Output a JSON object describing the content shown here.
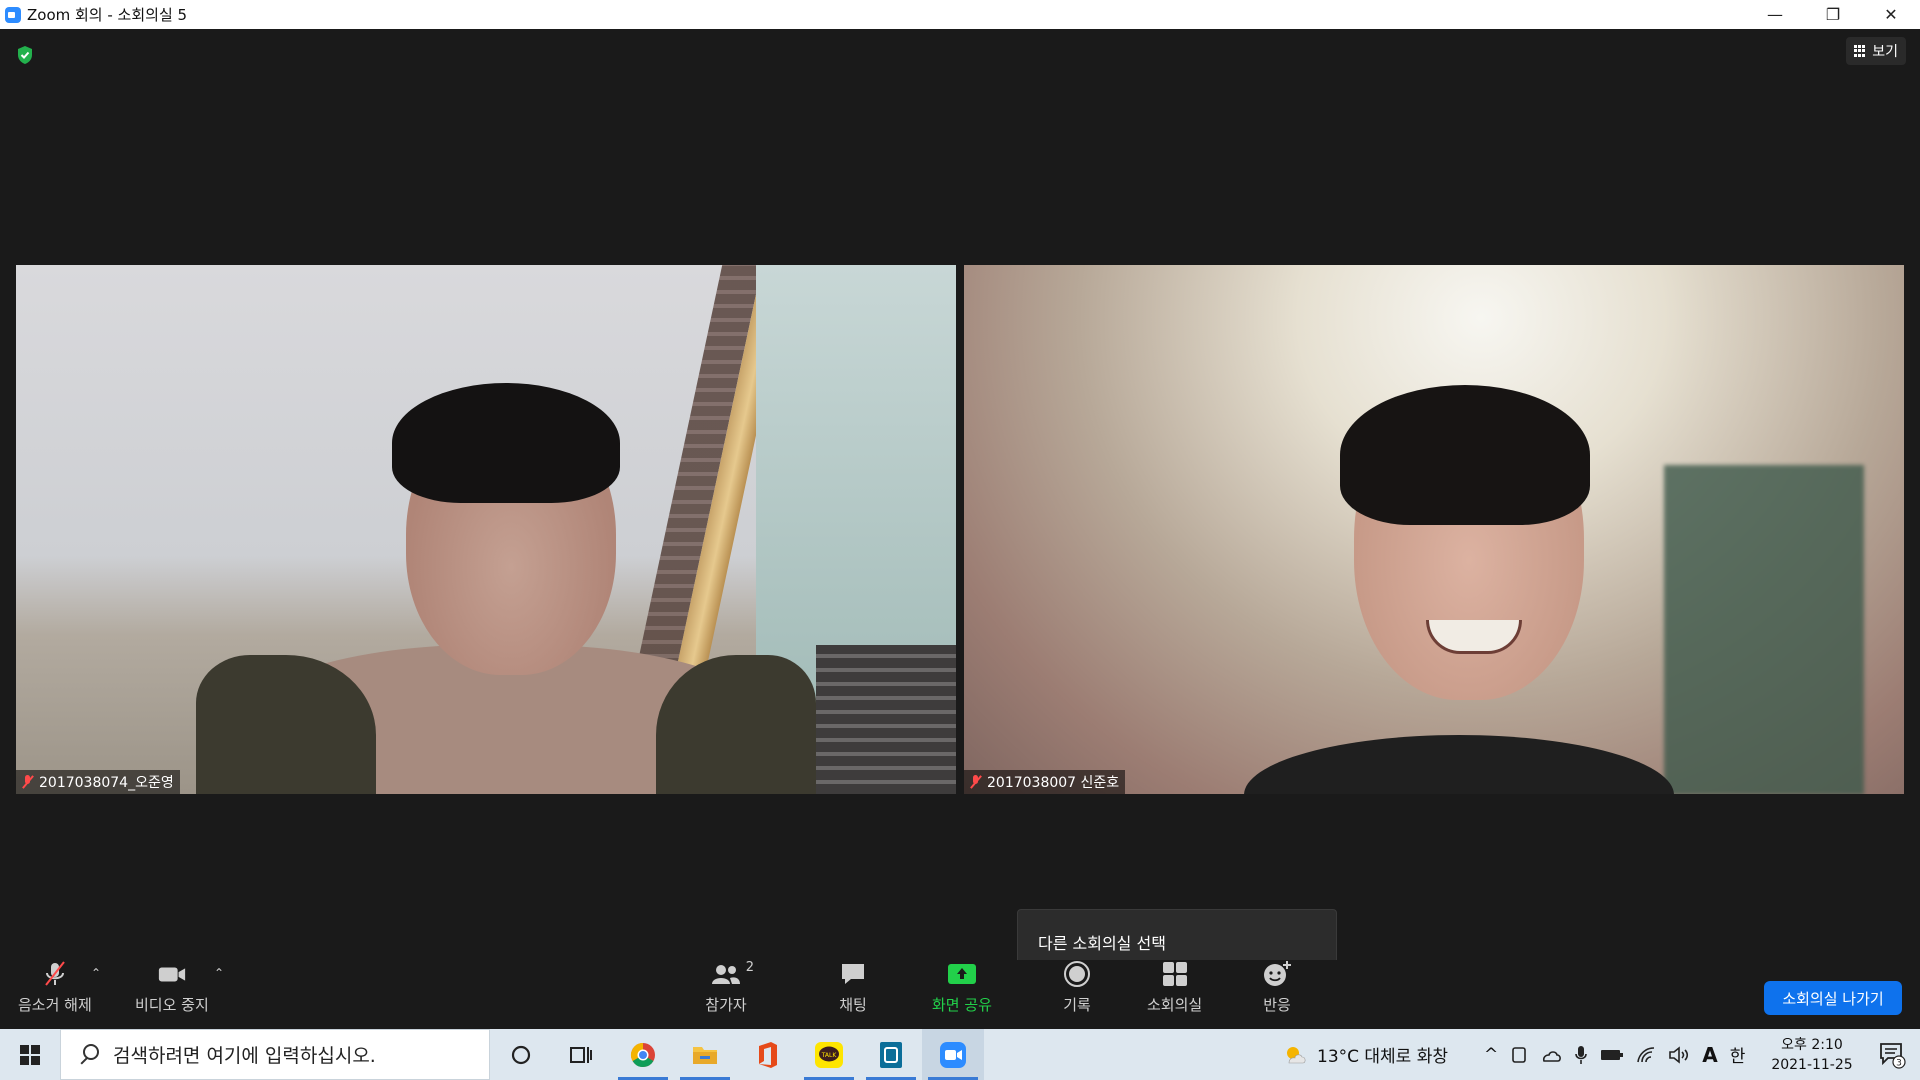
{
  "window": {
    "title": "Zoom 회의 - 소회의실 5",
    "minimize_glyph": "—",
    "restore_glyph": "❐",
    "close_glyph": "✕"
  },
  "top_right": {
    "view_label": "보기"
  },
  "participants": [
    {
      "name": "2017038074_오준영",
      "muted": true
    },
    {
      "name": "2017038007 신준호",
      "muted": true
    }
  ],
  "tooltip": {
    "text": "다른 소회의실 선택"
  },
  "toolbar": {
    "unmute_label": "음소거 해제",
    "stop_video_label": "비디오 중지",
    "participants_label": "참가자",
    "participants_count": "2",
    "chat_label": "채팅",
    "share_label": "화면 공유",
    "record_label": "기록",
    "breakout_label": "소회의실",
    "reactions_label": "반응",
    "leave_breakout_label": "소회의실 나가기",
    "caret_glyph": "⌃"
  },
  "taskbar": {
    "search_placeholder": "검색하려면 여기에 입력하십시오.",
    "apps": [
      "cortana",
      "task-view",
      "chrome",
      "file-explorer",
      "office",
      "kakaotalk",
      "app-window",
      "zoom"
    ],
    "kakao_label": "TALK",
    "weather": "13°C  대체로 화창",
    "tray_up_glyph": "^",
    "ime_letter": "A",
    "ime_mode": "한",
    "time": "오후 2:10",
    "date": "2021-11-25",
    "notification_count": "3"
  },
  "colors": {
    "accent_blue": "#0e72ed",
    "share_green": "#22d04a",
    "muted_red": "#ff4a4a",
    "meeting_bg": "#1a1a1a"
  }
}
